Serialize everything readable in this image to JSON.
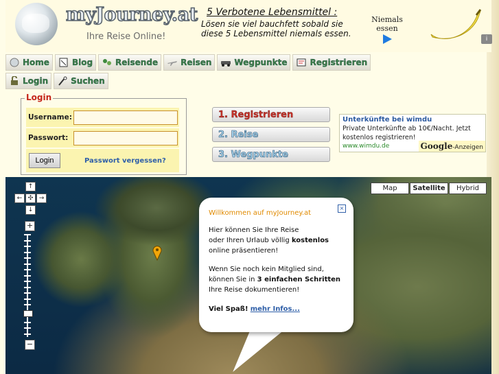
{
  "header": {
    "logo_text": "myJourney.at",
    "tagline": "Ihre Reise Online!",
    "promo_title": "5 Verbotene Lebensmittel :",
    "promo_line1": "Lösen sie viel bauchfett sobald sie",
    "promo_line2": "diese 5 Lebensmittel niemals essen.",
    "promo_side_1": "Niemals",
    "promo_side_2": "essen",
    "promo_badge": "i"
  },
  "nav": {
    "row1": [
      {
        "label": "Home",
        "icon": "globe-icon"
      },
      {
        "label": "Blog",
        "icon": "blog-icon"
      },
      {
        "label": "Reisende",
        "icon": "people-icon"
      },
      {
        "label": "Reisen",
        "icon": "plane-icon"
      },
      {
        "label": "Wegpunkte",
        "icon": "car-icon"
      },
      {
        "label": "Registrieren",
        "icon": "register-icon"
      }
    ],
    "row2": [
      {
        "label": "Login",
        "icon": "lock-icon"
      },
      {
        "label": "Suchen",
        "icon": "search-icon"
      }
    ]
  },
  "login": {
    "legend": "Login",
    "username_label": "Username:",
    "password_label": "Passwort:",
    "username_value": "",
    "password_value": "",
    "login_button": "Login",
    "forgot_link": "Passwort vergessen?"
  },
  "steps": {
    "step1": "1. Registrieren",
    "step2": "2. Reise",
    "step3": "3. Wegpunkte"
  },
  "ad": {
    "title": "Unterkünfte bei wimdu",
    "text": "Private Unterkünfte ab 10€/Nacht. Jetzt kostenlos registrieren!",
    "url": "www.wimdu.de",
    "google": "Google",
    "google_suffix": "-Anzeigen"
  },
  "map": {
    "type_map": "Map",
    "type_satellite": "Satellite",
    "type_hybrid": "Hybrid",
    "selected_type": "Satellite",
    "zoom_in": "+",
    "zoom_out": "−",
    "pan_up": "↑",
    "pan_down": "↓",
    "pan_left": "←",
    "pan_right": "→"
  },
  "info_window": {
    "title": "Willkommen auf myJourney.at",
    "close": "×",
    "p1_a": "Hier können Sie Ihre Reise",
    "p1_b": "oder Ihren Urlaub völlig",
    "p1_bold": "kostenlos",
    "p1_c": "online präsentieren!",
    "p2_a": "Wenn Sie noch kein Mitglied sind,",
    "p2_b": "können Sie in",
    "p2_bold": "3 einfachen Schritten",
    "p2_c": "Ihre Reise dokumentieren!",
    "p3_bold": "Viel Spaß!",
    "p3_link": "mehr Infos..."
  },
  "colors": {
    "login_legend": "#c4261b",
    "link_blue": "#2f5fa8",
    "info_title": "#e08a00",
    "login_row_bg": "#fbf4b0"
  }
}
